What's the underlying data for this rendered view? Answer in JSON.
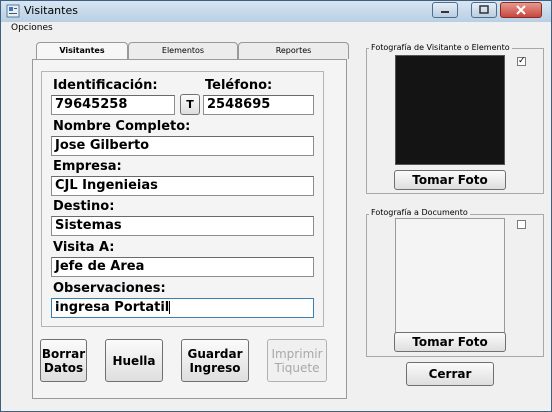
{
  "window": {
    "title": "Visitantes",
    "menu": "Opciones"
  },
  "tabs": [
    {
      "label": "Visitantes"
    },
    {
      "label": "Elementos"
    },
    {
      "label": "Reportes"
    }
  ],
  "form": {
    "identificacion_label": "Identificación:",
    "identificacion_value": "79645258",
    "t_button": "T",
    "telefono_label": "Teléfono:",
    "telefono_value": "2548695",
    "nombre_label": "Nombre Completo:",
    "nombre_value": "Jose Gilberto",
    "empresa_label": "Empresa:",
    "empresa_value": "CJL Ingenieias",
    "destino_label": "Destino:",
    "destino_value": "Sistemas",
    "visita_label": "Visita A:",
    "visita_value": "Jefe de Area",
    "observaciones_label": "Observaciones:",
    "observaciones_value": "ingresa Portatil"
  },
  "actions": {
    "borrar_1": "Borrar",
    "borrar_2": "Datos",
    "huella": "Huella",
    "guardar_1": "Guardar",
    "guardar_2": "Ingreso",
    "imprimir_1": "Imprimir",
    "imprimir_2": "Tiquete"
  },
  "photo_visitor": {
    "label": "Fotografía de Visitante o Elemento",
    "button": "Tomar Foto",
    "checked_mark": "✓"
  },
  "photo_document": {
    "label": "Fotografía a Documento",
    "button": "Tomar Foto"
  },
  "cerrar": "Cerrar",
  "colors": {
    "titlebar": "#c4d7ea",
    "photo_visitor_bg": "#141414",
    "close_button": "#c9463d"
  }
}
